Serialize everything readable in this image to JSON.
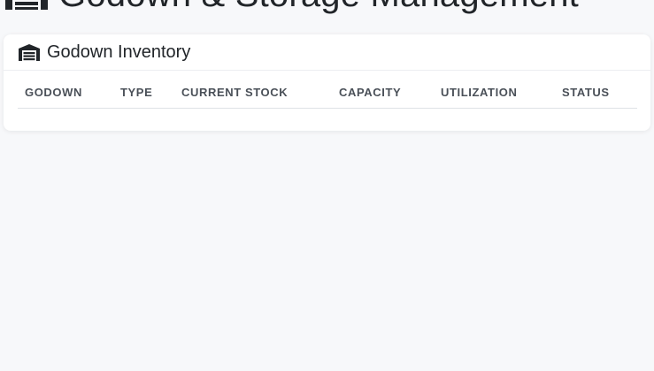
{
  "header": {
    "title": "Godown & Storage Management",
    "icon": "warehouse-icon"
  },
  "inventory_card": {
    "title": "Godown Inventory",
    "icon": "warehouse-icon",
    "columns": [
      "GODOWN",
      "TYPE",
      "CURRENT STOCK",
      "CAPACITY",
      "UTILIZATION",
      "STATUS"
    ],
    "rows": []
  },
  "colors": {
    "background": "#f7f8fa",
    "card": "#ffffff",
    "text": "#212529",
    "header_text": "#4a5058"
  }
}
